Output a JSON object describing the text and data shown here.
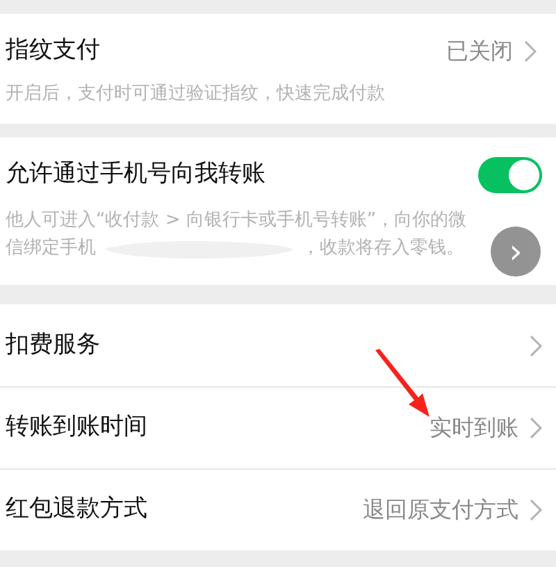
{
  "fingerprint": {
    "title": "指纹支付",
    "value": "已关闭",
    "description": "开启后，支付时可通过验证指纹，快速完成付款"
  },
  "phone_transfer": {
    "title": "允许通过手机号向我转账",
    "on": true,
    "description_line_1": "他人可进入“收付款 > 向银行卡或手机号转账”，向你的微",
    "description_start": "信绑定手机",
    "description_end": "，收款将存入零钱。",
    "floating_button": "›"
  },
  "rows": [
    {
      "label": "扣费服务",
      "value": null
    },
    {
      "label": "转账到账时间",
      "value": "实时到账"
    },
    {
      "label": "红包退款方式",
      "value": "退回原支付方式"
    }
  ]
}
